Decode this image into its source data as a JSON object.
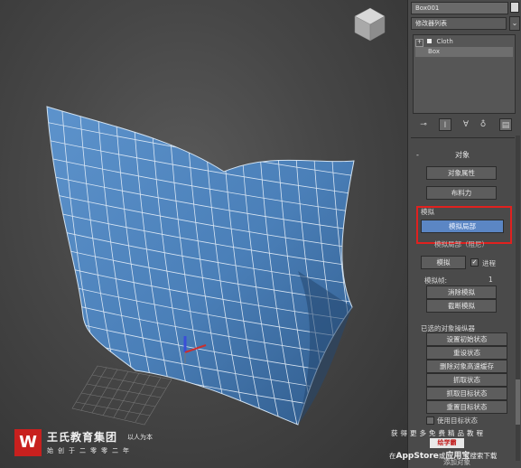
{
  "panel": {
    "object_name": "Box001",
    "modifier_list": "修改器列表",
    "dropdown_glyph": "⌄",
    "stack": [
      {
        "label": "Cloth",
        "prefix": "+"
      },
      {
        "label": "Box",
        "prefix": ""
      }
    ]
  },
  "toolbar": [
    "pin-icon",
    "show-end-icon",
    "make-unique-icon",
    "remove-modifier-icon",
    "configure-icon"
  ],
  "rollout": {
    "object": {
      "title": "对象",
      "collapse_glyph": "-",
      "object_properties": "对象属性",
      "cloth_forces": "布料力"
    },
    "simulation": {
      "title": "模拟",
      "simulate_local": "模拟局部",
      "simulate_local_damped": "模拟局部（阻尼）",
      "simulate": "模拟",
      "progress_checked": true,
      "progress_label": "进程",
      "sim_frame_label": "模拟帧:",
      "sim_frame_value": "1",
      "erase_simulation": "消除模拟",
      "truncate_simulation": "截断模拟"
    },
    "selected_object_manipulator": {
      "title": "已选的对象操纵器",
      "set_initial_state": "设置初始状态",
      "reset_state": "重设状态",
      "delete_object_cache": "删除对象高速缓存",
      "grab_state": "抓取状态",
      "grab_target_state": "抓取目标状态",
      "reset_target_state": "重置目标状态",
      "use_target_state_checked": false,
      "use_target_state": "使用目标状态"
    }
  },
  "watermark": {
    "logo_letter": "W",
    "company": "王氏教育集团",
    "slogan": "以人为本",
    "founded": "始创于二零零二年",
    "promo_line1": "获得更多免费精品教程",
    "promo_badge": "绘学霸",
    "promo_prefix": "在",
    "promo_store": "AppStore",
    "promo_mid": "或",
    "promo_app": "应用宝",
    "promo_suffix": "搜索下载",
    "add_object": "添加对象"
  },
  "colors": {
    "cloth": "#4f86c0",
    "highlight_button": "#5b86c4",
    "callout": "#e0211f",
    "brand_red": "#c8201e"
  }
}
